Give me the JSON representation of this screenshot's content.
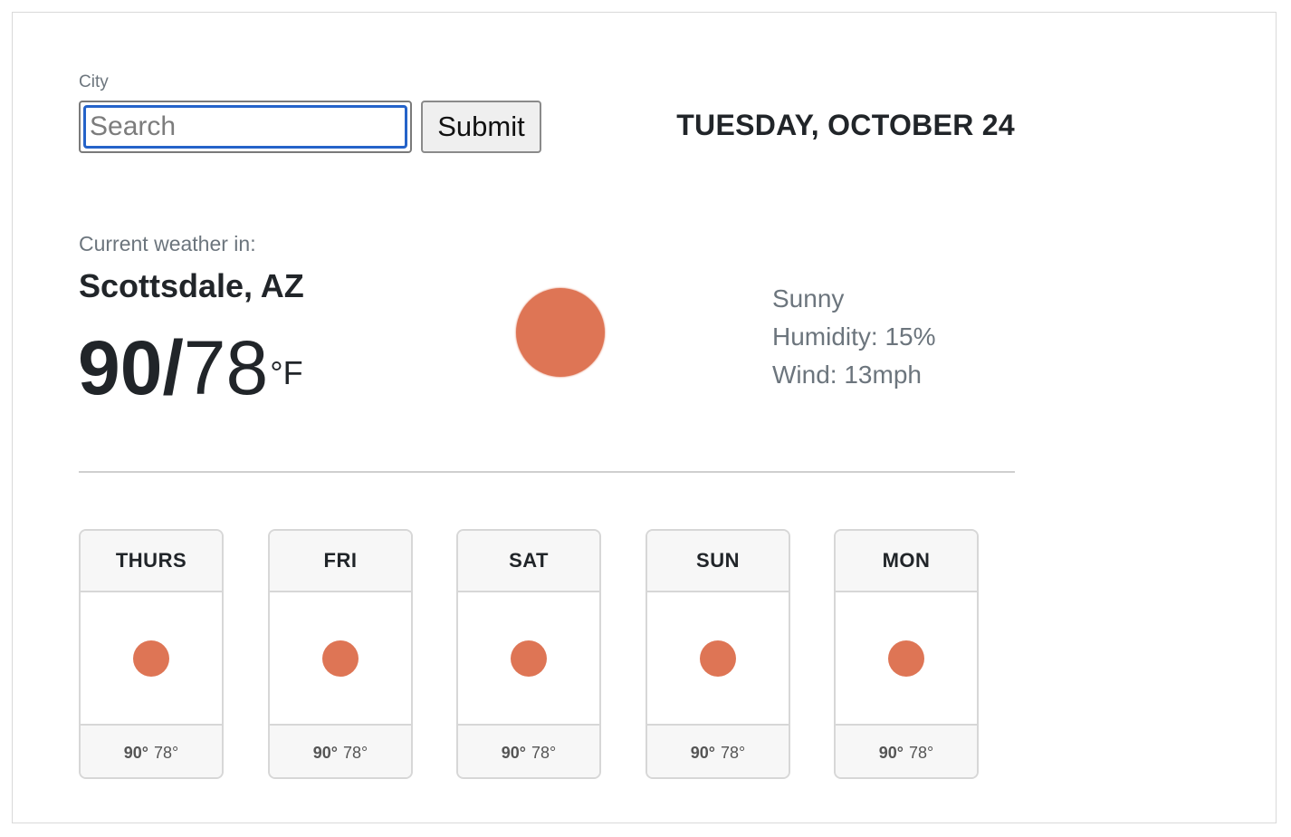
{
  "search": {
    "label": "City",
    "placeholder": "Search",
    "value": "",
    "submit_label": "Submit"
  },
  "date": "TUESDAY, OCTOBER 24",
  "current": {
    "label": "Current weather in:",
    "location": "Scottsdale, AZ",
    "high": "90",
    "separator": "/",
    "low": "78",
    "unit": "°F",
    "icon": "sun-icon",
    "condition": "Sunny",
    "humidity": "Humidity: 15%",
    "wind": "Wind: 13mph"
  },
  "forecast": [
    {
      "day": "THURS",
      "high": "90°",
      "low": "78°",
      "icon": "sun-icon"
    },
    {
      "day": "FRI",
      "high": "90°",
      "low": "78°",
      "icon": "sun-icon"
    },
    {
      "day": "SAT",
      "high": "90°",
      "low": "78°",
      "icon": "sun-icon"
    },
    {
      "day": "SUN",
      "high": "90°",
      "low": "78°",
      "icon": "sun-icon"
    },
    {
      "day": "MON",
      "high": "90°",
      "low": "78°",
      "icon": "sun-icon"
    }
  ],
  "colors": {
    "sun": "#de7555",
    "focus": "#2563c9",
    "muted_text": "#6c757d"
  }
}
